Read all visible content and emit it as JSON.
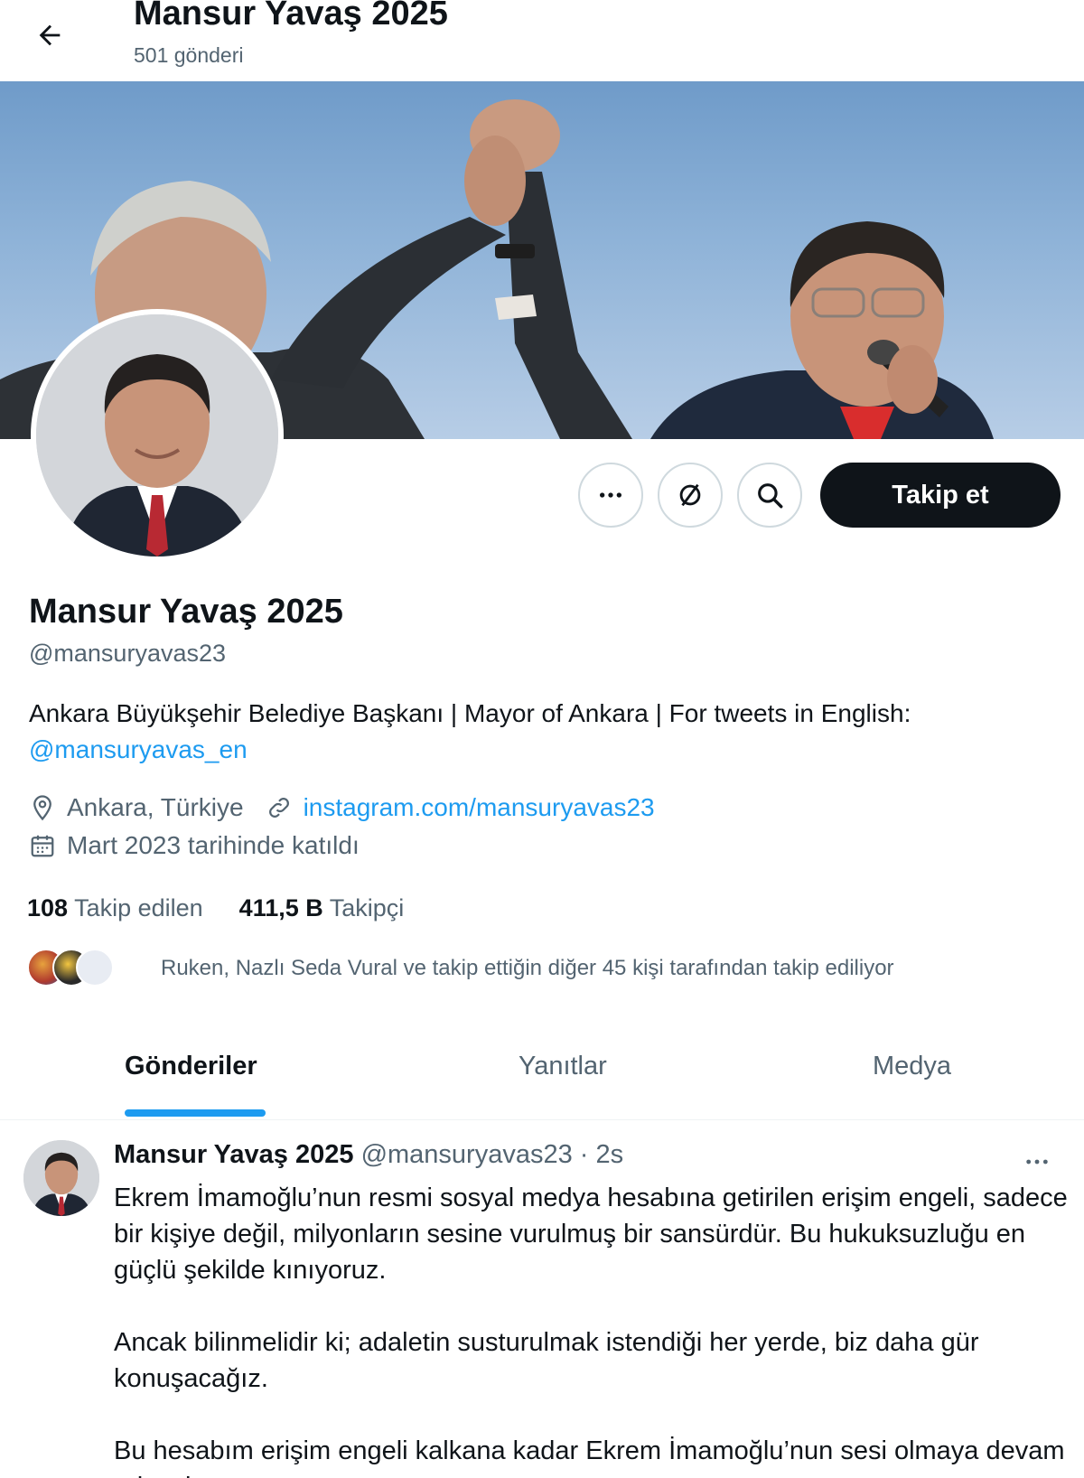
{
  "header": {
    "title": "Mansur Yavaş 2025",
    "post_count": "501 gönderi"
  },
  "actions": {
    "follow_label": "Takip et"
  },
  "profile": {
    "name": "Mansur Yavaş 2025",
    "handle": "@mansuryavas23",
    "bio_text": "Ankara Büyükşehir Belediye Başkanı | Mayor of Ankara | For tweets in English:",
    "bio_link": "@mansuryavas_en",
    "location": "Ankara, Türkiye",
    "website": "instagram.com/mansuryavas23",
    "joined": "Mart 2023 tarihinde katıldı"
  },
  "stats": {
    "following_count": "108",
    "following_label": "Takip edilen",
    "followers_count": "411,5 B",
    "followers_label": "Takipçi"
  },
  "followed_by": "Ruken, Nazlı Seda Vural ve takip ettiğin diğer 45 kişi tarafından takip ediliyor",
  "tabs": [
    "Gönderiler",
    "Yanıtlar",
    "Medya"
  ],
  "tweet": {
    "author": "Mansur Yavaş 2025",
    "handle": "@mansuryavas23",
    "time": "· 2s",
    "paragraphs": [
      "Ekrem İmamoğlu’nun resmi sosyal medya hesabına getirilen erişim engeli, sadece bir kişiye değil, milyonların sesine vurulmuş bir sansürdür. Bu hukuksuzluğu en güçlü şekilde kınıyoruz.",
      "Ancak bilinmelidir ki; adaletin susturulmak istendiği her yerde, biz daha gür konuşacağız.",
      "Bu hesabım erişim engeli kalkana kadar Ekrem İmamoğlu’nun sesi olmaya devam edecek."
    ]
  },
  "colors": {
    "accent": "#1d9bf0",
    "text": "#0f1419",
    "muted": "#536471",
    "follow_button": "#0f1419"
  },
  "icons": [
    "back-arrow-icon",
    "more-icon",
    "notifications-off-icon",
    "search-icon",
    "location-icon",
    "link-icon",
    "calendar-icon"
  ]
}
